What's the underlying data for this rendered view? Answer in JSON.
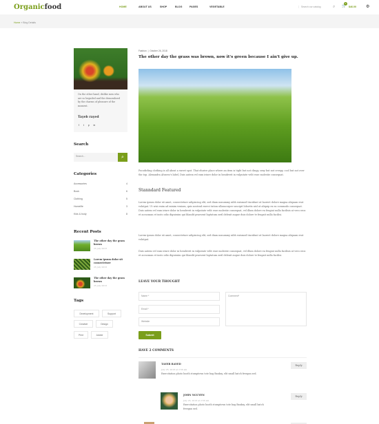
{
  "header": {
    "logo_a": "Organic",
    "logo_b": "food",
    "nav": [
      "HOME",
      "ABOUT US",
      "SHOP",
      "BLOG",
      "PAGES",
      "VEGETABLE"
    ],
    "search_placeholder": "Search our catalog",
    "cart_count": "0",
    "cart_total": "$46.00",
    "accent": "#7a9e1a"
  },
  "breadcrumb": {
    "home": "Home",
    "sep": "»",
    "current": "Blog Details"
  },
  "author": {
    "bio": "On the other hand, dislike men who are so beguiled and the demoralized by the charms of pleasure of the moment.",
    "name": "Tayeb rayed",
    "social": [
      "f",
      "t",
      "p",
      "in"
    ]
  },
  "search": {
    "title": "Search",
    "placeholder": "Search..."
  },
  "categories": {
    "title": "Categories",
    "items": [
      {
        "label": "Accessories",
        "count": "4"
      },
      {
        "label": "Book",
        "count": "6"
      },
      {
        "label": "Clothing",
        "count": "5"
      },
      {
        "label": "Homelife",
        "count": "3"
      },
      {
        "label": "Kids & body",
        "count": "8"
      }
    ]
  },
  "recent": {
    "title": "Recent Posts",
    "items": [
      {
        "title": "The other day the grass brown",
        "date": "25 july 2018"
      },
      {
        "title": "Lorem ipsum dolor sit consectetuer",
        "date": "25 july 2018"
      },
      {
        "title": "The other day the grass brown",
        "date": "25 july 2018"
      }
    ]
  },
  "tags": {
    "title": "Tags",
    "items": [
      "Development",
      "Support",
      "Creative",
      "Design",
      "Print",
      "Adobe"
    ]
  },
  "post": {
    "category": "Fashion",
    "date": "October 26, 2018",
    "title": "The other day the grass was brown, now it's green because I ain't give up.",
    "intro": "Pocodirling clothing is all about a sweet spot. That elusive place where an item is tight but not clingy, sexy but not creepy, cool but not over the top. Alexandra Alvarez's label, Duis autem vel eum iriure dolor in hendrerit in vulputate velit esse molestie consequat.",
    "subheading": "Stanndard Featured",
    "p1": "Lorem ipsum dolor sit amet, consectetuer adipiscing elit, sed diam nonummy nibh euismod tincidunt ut laoreet dolore magna aliquam erat volutpat. Ut wisi enim ad minim veniam, quis nostrud exerci tation ullamcorper suscipit lobortis nisl ut aliquip ex ea commodo consequat. Duis autem vel eum iriure dolor in hendrerit in vulputate velit esse molestie consequat, vel illum dolore eu feugiat nulla facilisis at vero eros et accumsan et iusto odio dignissim qui blandit praesent luptatum zzril delenit augue duis dolore te feugait nulla facilisi.",
    "p2": "Lorem ipsum dolor sit amet, consectetuer adipiscing elit, sed diam nonummy nibh euismod tincidunt ut laoreet dolore magna aliquam erat volutpat.",
    "p3": "Duis autem vel eum iriure dolor in hendrerit in vulputate velit esse molestie consequat, vel illum dolore eu feugiat nulla facilisis at vero eros et accumsan et iusto odio dignissim qui blandit praesent luptatum zzril delenit augue duis dolore te feugait nulla facilisi."
  },
  "form": {
    "title": "LEAVE YOUR THOUGHT",
    "name": "Name *",
    "email": "Email *",
    "website": "Website",
    "comment": "Comment*",
    "submit": "Submit"
  },
  "comments": {
    "title": "HAVE 2 COMMENTS",
    "reply": "Reply",
    "items": [
      {
        "name": "TAYEB RAYED",
        "date": "July 25, 2018 at 2:56 am",
        "text": "Exercitation photo booth stumptown tote bag Banksy, elit small batch freegan sed."
      },
      {
        "name": "JOHN NGUYEN",
        "date": "July 25, 2018 at 2:56 am",
        "text": "Exercitation photo booth stumptown tote bag Banksy, elit small batch freegan sed."
      }
    ]
  }
}
